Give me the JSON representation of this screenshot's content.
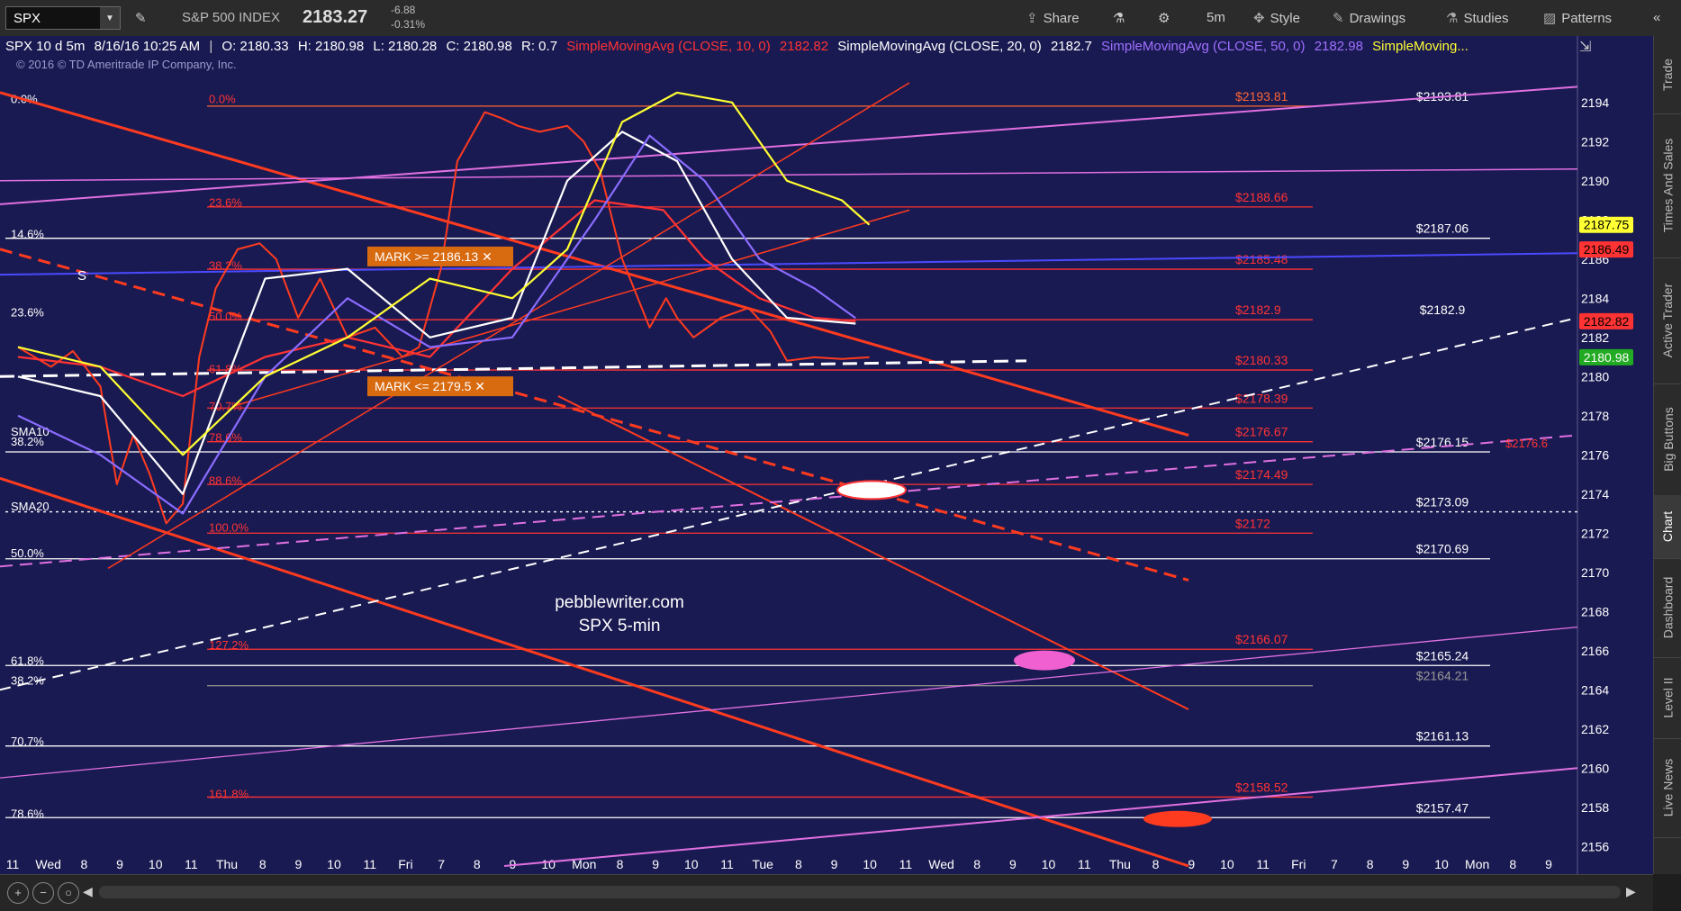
{
  "toolbar": {
    "symbol": "SPX",
    "instrument_name": "S&P 500 INDEX",
    "last_price": "2183.27",
    "change": "-6.88",
    "change_pct": "-0.31%",
    "timeframe": "5m",
    "buttons": {
      "share": "Share",
      "style": "Style",
      "drawings": "Drawings",
      "studies": "Studies",
      "patterns": "Patterns"
    }
  },
  "info_bar": {
    "header": "SPX 10 d 5m",
    "datetime": "8/16/16 10:25 AM",
    "open": "O: 2180.33",
    "high": "H: 2180.98",
    "low": "L: 2180.28",
    "close": "C: 2180.98",
    "range": "R: 0.7",
    "studies": [
      {
        "name": "SimpleMovingAvg (CLOSE, 10, 0)",
        "value": "2182.82",
        "color": "#ff3333"
      },
      {
        "name": "SimpleMovingAvg (CLOSE, 20, 0)",
        "value": "2182.7",
        "color": "#ffffff"
      },
      {
        "name": "SimpleMovingAvg (CLOSE, 50, 0)",
        "value": "2182.98",
        "color": "#a070ff"
      },
      {
        "name": "SimpleMoving...",
        "value": "",
        "color": "#ffff33"
      }
    ]
  },
  "right_tabs": [
    "Trade",
    "Times And Sales",
    "Active Trader",
    "Big Buttons",
    "Chart",
    "Dashboard",
    "Level II",
    "Live News"
  ],
  "watermark": {
    "copyright": "© 2016 © TD Ameritrade IP Company, Inc.",
    "site": "pebblewriter.com",
    "subtitle": "SPX 5-min"
  },
  "chart_data": {
    "type": "line",
    "title": "SPX 10 d 5m",
    "ylim": [
      2155,
      2195
    ],
    "y_ticks": [
      2156,
      2158,
      2160,
      2162,
      2164,
      2166,
      2168,
      2170,
      2172,
      2174,
      2176,
      2178,
      2180,
      2182,
      2184,
      2186,
      2188,
      2190,
      2192,
      2194
    ],
    "x_ticks": [
      "11",
      "Wed",
      "8",
      "9",
      "10",
      "11",
      "Thu",
      "8",
      "9",
      "10",
      "11",
      "Fri",
      "7",
      "8",
      "9",
      "10",
      "Mon",
      "8",
      "9",
      "10",
      "11",
      "Tue",
      "8",
      "9",
      "10",
      "11",
      "Wed",
      "8",
      "9",
      "10",
      "11",
      "Thu",
      "8",
      "9",
      "10",
      "11",
      "Fri",
      "7",
      "8",
      "9",
      "10",
      "Mon",
      "8",
      "9"
    ],
    "series": [
      {
        "name": "SPX",
        "color": "#ff3b1f",
        "x": [
          0.0,
          1.2,
          2.0,
          3.0,
          3.6,
          4.2,
          4.8,
          5.4,
          6.0,
          6.6,
          7.2,
          8.0,
          8.8,
          9.4,
          10.2,
          11.0,
          12.0,
          13.0,
          14.0,
          14.6,
          15.4,
          16.0,
          17.0,
          17.6,
          18.2,
          19.0,
          20.0,
          20.6,
          21.2,
          22.0,
          23.0,
          23.6,
          24.0,
          24.6,
          25.6,
          26.6,
          27.4,
          28.0,
          29.0,
          30.0,
          31.0
        ],
        "values": [
          2181.5,
          2180.5,
          2181.3,
          2179.5,
          2174.5,
          2177.0,
          2175.0,
          2172.5,
          2173.5,
          2181.0,
          2184.5,
          2186.5,
          2186.8,
          2186.0,
          2183.0,
          2185.0,
          2182.0,
          2182.5,
          2181.0,
          2181.5,
          2185.5,
          2191.0,
          2193.5,
          2193.2,
          2192.8,
          2192.5,
          2192.8,
          2192.0,
          2190.5,
          2186.0,
          2182.5,
          2184.0,
          2183.0,
          2182.0,
          2183.0,
          2183.5,
          2182.3,
          2180.8,
          2180.98,
          2180.9,
          2180.98
        ]
      },
      {
        "name": "SimpleMovingAvg (CLOSE, 10, 0)",
        "color": "#ff3333",
        "x": [
          0.0,
          3.0,
          6.0,
          9.0,
          12.0,
          15.0,
          18.0,
          21.0,
          23.5,
          25.0,
          27.0,
          29.0,
          30.5
        ],
        "values": [
          2181.0,
          2180.5,
          2179.0,
          2181.0,
          2182.0,
          2181.0,
          2185.5,
          2189.0,
          2188.5,
          2186.0,
          2184.0,
          2183.0,
          2182.82
        ]
      },
      {
        "name": "SimpleMovingAvg (CLOSE, 20, 0)",
        "color": "#ffffff",
        "x": [
          0.0,
          3.0,
          6.0,
          9.0,
          12.0,
          15.0,
          18.0,
          20.0,
          22.0,
          24.0,
          26.0,
          28.0,
          30.5
        ],
        "values": [
          2180.0,
          2179.0,
          2174.0,
          2185.0,
          2185.5,
          2182.0,
          2183.0,
          2190.0,
          2192.5,
          2191.0,
          2186.0,
          2183.0,
          2182.7
        ]
      },
      {
        "name": "SimpleMovingAvg (CLOSE, 50, 0)",
        "color": "#8a6cff",
        "x": [
          0.0,
          3.0,
          6.0,
          9.0,
          12.0,
          15.0,
          18.0,
          21.0,
          23.0,
          25.0,
          27.0,
          29.0,
          30.5
        ],
        "values": [
          2178.0,
          2176.0,
          2173.0,
          2180.0,
          2184.0,
          2181.5,
          2182.0,
          2188.0,
          2192.3,
          2190.0,
          2186.0,
          2184.5,
          2182.98
        ]
      },
      {
        "name": "SimpleMoving...",
        "color": "#ffff33",
        "x": [
          0.0,
          3.0,
          6.0,
          9.0,
          12.0,
          15.0,
          18.0,
          20.0,
          22.0,
          24.0,
          26.0,
          28.0,
          30.0,
          31.0
        ],
        "values": [
          2181.5,
          2180.5,
          2176.0,
          2180.0,
          2182.0,
          2185.0,
          2184.0,
          2186.5,
          2193.0,
          2194.5,
          2194.0,
          2190.0,
          2189.0,
          2187.75
        ]
      }
    ],
    "price_badges": [
      {
        "value": "2187.75",
        "bg": "#ffff33",
        "fg": "#000000"
      },
      {
        "value": "2186.49",
        "bg": "#ff3333",
        "fg": "#000000"
      },
      {
        "value": "2182.82",
        "bg": "#ff3333",
        "fg": "#000000"
      },
      {
        "value": "2180.98",
        "bg": "#22aa22",
        "fg": "#ffffff"
      }
    ],
    "horizontal_levels": [
      {
        "value": 2193.81,
        "label": "$2193.81",
        "color": "#ff6633",
        "right_label": "$2193.81",
        "right_color": "#ffffff"
      },
      {
        "value": 2188.66,
        "label": "$2188.66",
        "color": "#ff3333"
      },
      {
        "value": 2187.06,
        "label": "",
        "color": "#ffffff",
        "right_label": "$2187.06",
        "right_color": "#ffffff"
      },
      {
        "value": 2185.48,
        "label": "$2185.48",
        "color": "#ff3333"
      },
      {
        "value": 2182.9,
        "label": "$2182.9",
        "color": "#ff3333",
        "right_label": "$2182.9",
        "right_color": "#ffffff"
      },
      {
        "value": 2180.33,
        "label": "$2180.33",
        "color": "#ff3333"
      },
      {
        "value": 2178.39,
        "label": "$2178.39",
        "color": "#ff3333"
      },
      {
        "value": 2176.67,
        "label": "$2176.67",
        "color": "#ff3333"
      },
      {
        "value": 2176.15,
        "label": "",
        "color": "#ffffff",
        "right_label": "$2176.15",
        "right_color": "#ffffff"
      },
      {
        "value": 2174.49,
        "label": "$2174.49",
        "color": "#ff3333"
      },
      {
        "value": 2173.09,
        "label": "",
        "color": "#ffffff",
        "right_label": "$2173.09",
        "right_color": "#ffffff",
        "dotted": true
      },
      {
        "value": 2172,
        "label": "$2172",
        "color": "#ff3333"
      },
      {
        "value": 2170.69,
        "label": "",
        "color": "#ffffff",
        "right_label": "$2170.69",
        "right_color": "#ffffff"
      },
      {
        "value": 2166.07,
        "label": "$2166.07",
        "color": "#ff3333"
      },
      {
        "value": 2165.24,
        "label": "",
        "color": "#ffffff",
        "right_label": "$2165.24",
        "right_color": "#ffffff"
      },
      {
        "value": 2164.21,
        "label": "",
        "color": "#888888",
        "right_label": "$2164.21",
        "right_color": "#999999"
      },
      {
        "value": 2161.13,
        "label": "",
        "color": "#ffffff",
        "right_label": "$2161.13",
        "right_color": "#ffffff"
      },
      {
        "value": 2158.52,
        "label": "$2158.52",
        "color": "#ff3333"
      },
      {
        "value": 2157.47,
        "label": "",
        "color": "#ffffff",
        "right_label": "$2157.47",
        "right_color": "#ffffff"
      }
    ],
    "fib_labels_left": [
      {
        "text": "0.0%",
        "value": 2194.2
      },
      {
        "text": "14.6%",
        "value": 2187.3
      },
      {
        "text": "23.6%",
        "value": 2183.3
      },
      {
        "text": "SMA10",
        "value": 2177.2
      },
      {
        "text": "38.2%",
        "value": 2176.7
      },
      {
        "text": "SMA20",
        "value": 2173.4
      },
      {
        "text": "50.0%",
        "value": 2171.0
      },
      {
        "text": "61.8%",
        "value": 2165.5
      },
      {
        "text": "38.2%",
        "value": 2164.5
      },
      {
        "text": "70.7%",
        "value": 2161.4
      },
      {
        "text": "78.6%",
        "value": 2157.7
      }
    ],
    "fib_labels_inner": [
      {
        "text": "0.0%",
        "value": 2194.2
      },
      {
        "text": "23.6%",
        "value": 2188.9
      },
      {
        "text": "38.2%",
        "value": 2185.7
      },
      {
        "text": "50.0%",
        "value": 2183.1
      },
      {
        "text": "61.8%",
        "value": 2180.4
      },
      {
        "text": "70.7%",
        "value": 2178.5
      },
      {
        "text": "78.6%",
        "value": 2176.9
      },
      {
        "text": "88.6%",
        "value": 2174.7
      },
      {
        "text": "100.0%",
        "value": 2172.3
      },
      {
        "text": "127.2%",
        "value": 2166.3
      },
      {
        "text": "161.8%",
        "value": 2158.7
      }
    ],
    "alerts": [
      {
        "text": "MARK >= 2186.13 ✕",
        "value": 2186.13
      },
      {
        "text": "MARK <= 2179.5 ✕",
        "value": 2179.5
      }
    ],
    "annotations": [
      {
        "text": "$2176.6",
        "value": 2176.6
      },
      {
        "text": "S",
        "value": 2185.2
      }
    ]
  }
}
